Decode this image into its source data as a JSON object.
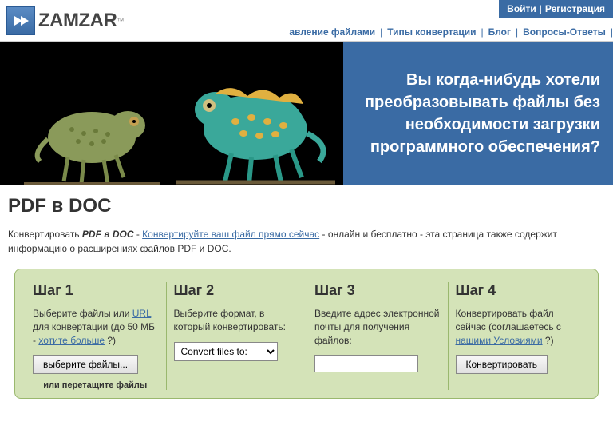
{
  "logo": {
    "text": "ZAMZAR",
    "tm": "™"
  },
  "auth": {
    "login": "Войти",
    "register": "Регистрация"
  },
  "nav": {
    "item1": "авление файлами",
    "item2": "Типы конвертации",
    "item3": "Блог",
    "item4": "Вопросы-Ответы"
  },
  "hero": {
    "text": "Вы когда-нибудь хотели преобразовывать файлы без необходимости загрузки программного обеспечения?"
  },
  "page_title": "PDF в DOC",
  "desc": {
    "pre": "Конвертировать ",
    "bold": "PDF в DOC",
    "mid": " - ",
    "link": "Конвертируйте ваш файл прямо сейчас",
    "post": " - онлайн и бесплатно - эта страница также содержит информацию о расширениях файлов PDF и DOC."
  },
  "steps": {
    "s1": {
      "title": "Шаг 1",
      "pre": "Выберите файлы или ",
      "url_link": "URL",
      "mid": " для конвертации (до 50 МБ - ",
      "more_link": "хотите больше",
      "post": " ?)",
      "button": "выберите файлы...",
      "drag": "или перетащите файлы"
    },
    "s2": {
      "title": "Шаг 2",
      "desc": "Выберите формат, в который конвертировать:",
      "select": "Convert files to:"
    },
    "s3": {
      "title": "Шаг 3",
      "desc": "Введите адрес электронной почты для получения файлов:"
    },
    "s4": {
      "title": "Шаг 4",
      "pre": "Конвертировать файл сейчас (соглашаетесь с ",
      "terms_link": "нашими Условиями",
      "post": " ?)",
      "button": "Конвертировать"
    }
  }
}
